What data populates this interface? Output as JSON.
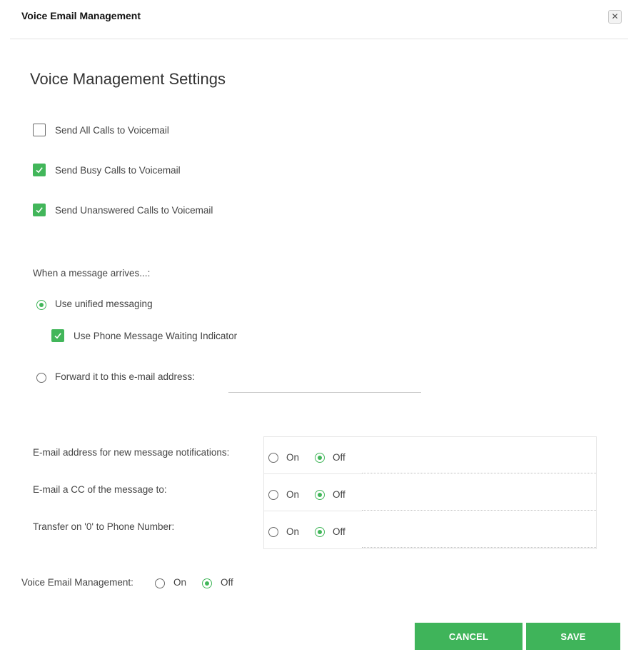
{
  "dialog": {
    "title": "Voice Email Management",
    "close_icon": "close-icon",
    "close_glyph": "✕"
  },
  "section_title": "Voice Management Settings",
  "send_options": [
    {
      "label": "Send All Calls to Voicemail",
      "checked": false
    },
    {
      "label": "Send Busy Calls to Voicemail",
      "checked": true
    },
    {
      "label": "Send Unanswered Calls to Voicemail",
      "checked": true
    }
  ],
  "message_arrival": {
    "heading": "When a message arrives...:",
    "unified_label": "Use unified messaging",
    "unified_selected": true,
    "mwi_label": "Use Phone Message Waiting Indicator",
    "mwi_checked": true,
    "forward_label": "Forward it to this e-mail address:",
    "forward_selected": false,
    "forward_value": ""
  },
  "notification_rows": [
    {
      "label": "E-mail address for new message notifications:",
      "on_label": "On",
      "off_label": "Off",
      "value": "Off"
    },
    {
      "label": "E-mail a CC of the message to:",
      "on_label": "On",
      "off_label": "Off",
      "value": "Off"
    },
    {
      "label": "Transfer on '0' to Phone Number:",
      "on_label": "On",
      "off_label": "Off",
      "value": "Off"
    }
  ],
  "voice_email_management": {
    "label": "Voice Email Management:",
    "on_label": "On",
    "off_label": "Off",
    "value": "Off"
  },
  "buttons": {
    "cancel": "CANCEL",
    "save": "SAVE"
  },
  "colors": {
    "accent": "#42b65a",
    "button": "#3fb45a"
  }
}
